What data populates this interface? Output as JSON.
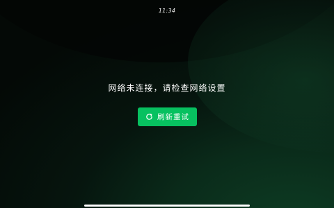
{
  "status_bar": {
    "time": "11:34"
  },
  "error": {
    "message": "网络未连接，请检查网络设置",
    "retry_label": "刷新重试",
    "retry_icon": "refresh-icon"
  },
  "colors": {
    "accent": "#07c160",
    "text": "#ffffff",
    "background": "#06150e"
  }
}
